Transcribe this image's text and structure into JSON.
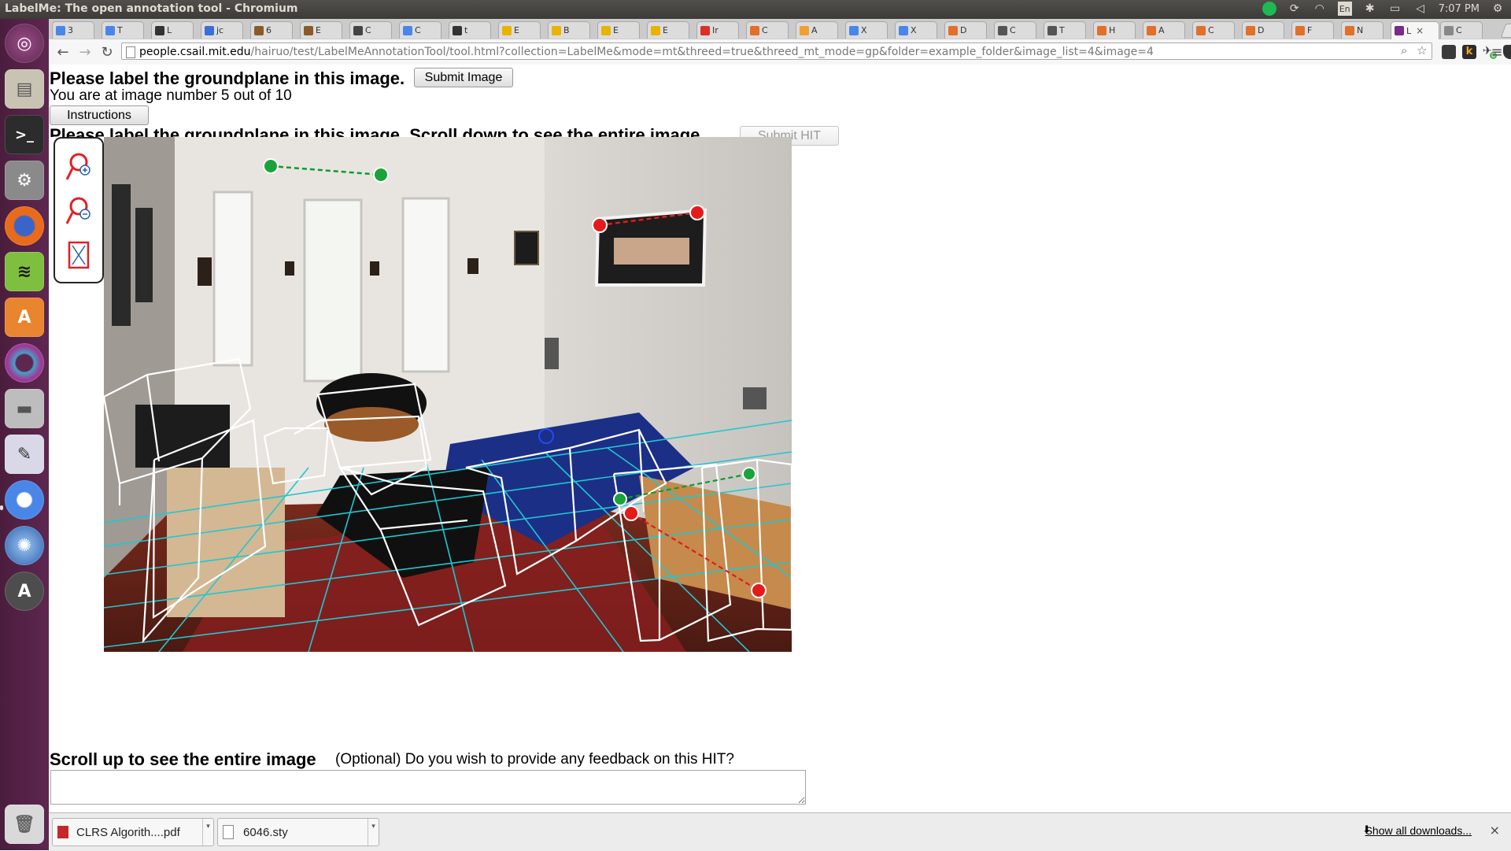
{
  "window": {
    "title": "LabelMe: The open annotation tool - Chromium"
  },
  "panel": {
    "clock": "7:07 PM",
    "keyboard": "En"
  },
  "tabs": [
    {
      "label": "3",
      "color": "#4a86e8"
    },
    {
      "label": "T",
      "color": "#4a86e8"
    },
    {
      "label": "L",
      "color": "#333333"
    },
    {
      "label": "jc",
      "color": "#3a6fd8"
    },
    {
      "label": "6",
      "color": "#8a5a2b"
    },
    {
      "label": "E",
      "color": "#8a5a2b"
    },
    {
      "label": "C",
      "color": "#444444"
    },
    {
      "label": "C",
      "color": "#4a86e8"
    },
    {
      "label": "t",
      "color": "#333333"
    },
    {
      "label": "E",
      "color": "#e8b400"
    },
    {
      "label": "B",
      "color": "#e8b400"
    },
    {
      "label": "E",
      "color": "#e8b400"
    },
    {
      "label": "E",
      "color": "#e8b400"
    },
    {
      "label": "Ir",
      "color": "#d93025"
    },
    {
      "label": "C",
      "color": "#e0702a"
    },
    {
      "label": "A",
      "color": "#f0a030"
    },
    {
      "label": "X",
      "color": "#4a86e8"
    },
    {
      "label": "X",
      "color": "#4a86e8"
    },
    {
      "label": "D",
      "color": "#e0702a"
    },
    {
      "label": "C",
      "color": "#555555"
    },
    {
      "label": "T",
      "color": "#555555"
    },
    {
      "label": "H",
      "color": "#e0702a"
    },
    {
      "label": "A",
      "color": "#e0702a"
    },
    {
      "label": "C",
      "color": "#e0702a"
    },
    {
      "label": "D",
      "color": "#e0702a"
    },
    {
      "label": "F",
      "color": "#e0702a"
    },
    {
      "label": "N",
      "color": "#e0702a"
    },
    {
      "label": "L",
      "color": "#7a2a8a",
      "active": true
    },
    {
      "label": "C",
      "color": "#888888"
    }
  ],
  "toolbar": {
    "url_host": "people.csail.mit.edu",
    "url_path": "/hairuo/test/LabelMeAnnotationTool/tool.html?collection=LabelMe&mode=mt&threed=true&threed_mt_mode=gp&folder=example_folder&image_list=4&image=4",
    "ext_badge": "6"
  },
  "page": {
    "heading_top": "Please label the groundplane in this image.",
    "submit_image_label": "Submit Image",
    "image_counter": "You are at image number 5 out of 10",
    "instructions_label": "Instructions",
    "heading_second": "Please label the groundplane in this image. Scroll down to see the entire image.",
    "submit_hit_label": "Submit HIT",
    "scroll_up_text": "Scroll up to see the entire image",
    "feedback_prompt": "(Optional) Do you wish to provide any feedback on this HIT?",
    "feedback_value": ""
  },
  "tools": [
    {
      "name": "zoom-in-icon"
    },
    {
      "name": "zoom-out-icon"
    },
    {
      "name": "fit-image-icon"
    }
  ],
  "downloads": {
    "items": [
      {
        "label": "CLRS Algorith....pdf",
        "type": "pdf"
      },
      {
        "label": "6046.sty",
        "type": "file"
      }
    ],
    "show_all_label": "Show all downloads..."
  },
  "annotation_colors": {
    "box_edges": "#ffffff",
    "ground_grid": "#1ec8d2",
    "vanishing_line_green": "#0f9a2b",
    "vanishing_line_red": "#e41b1b"
  }
}
